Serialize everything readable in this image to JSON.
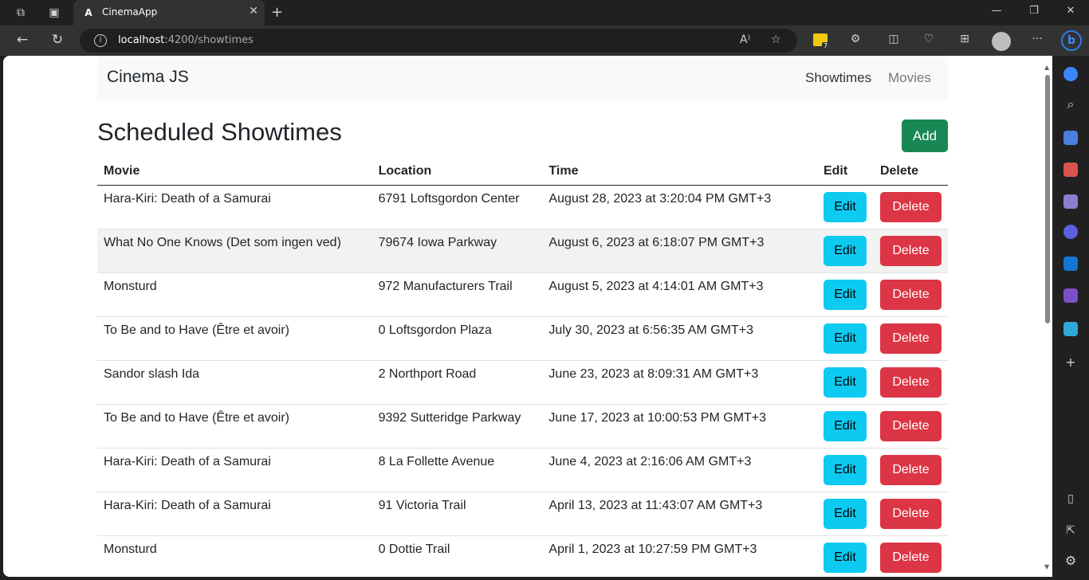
{
  "browser": {
    "tab_title": "CinemaApp",
    "tab_logo": "A",
    "url_host": "localhost",
    "url_path": ":4200/showtimes",
    "extension_badge_count": "7"
  },
  "navbar": {
    "brand": "Cinema JS",
    "links": [
      "Showtimes",
      "Movies"
    ]
  },
  "page": {
    "title": "Scheduled Showtimes",
    "add_label": "Add"
  },
  "table": {
    "headers": [
      "Movie",
      "Location",
      "Time",
      "Edit",
      "Delete"
    ],
    "edit_label": "Edit",
    "delete_label": "Delete",
    "rows": [
      {
        "movie": "Hara-Kiri: Death of a Samurai",
        "location": "6791 Loftsgordon Center",
        "time": "August 28, 2023 at 3:20:04 PM GMT+3"
      },
      {
        "movie": "What No One Knows (Det som ingen ved)",
        "location": "79674 Iowa Parkway",
        "time": "August 6, 2023 at 6:18:07 PM GMT+3"
      },
      {
        "movie": "Monsturd",
        "location": "972 Manufacturers Trail",
        "time": "August 5, 2023 at 4:14:01 AM GMT+3"
      },
      {
        "movie": "To Be and to Have (Être et avoir)",
        "location": "0 Loftsgordon Plaza",
        "time": "July 30, 2023 at 6:56:35 AM GMT+3"
      },
      {
        "movie": "Sandor slash Ida",
        "location": "2 Northport Road",
        "time": "June 23, 2023 at 8:09:31 AM GMT+3"
      },
      {
        "movie": "To Be and to Have (Être et avoir)",
        "location": "9392 Sutteridge Parkway",
        "time": "June 17, 2023 at 10:00:53 PM GMT+3"
      },
      {
        "movie": "Hara-Kiri: Death of a Samurai",
        "location": "8 La Follette Avenue",
        "time": "June 4, 2023 at 2:16:06 AM GMT+3"
      },
      {
        "movie": "Hara-Kiri: Death of a Samurai",
        "location": "91 Victoria Trail",
        "time": "April 13, 2023 at 11:43:07 AM GMT+3"
      },
      {
        "movie": "Monsturd",
        "location": "0 Dottie Trail",
        "time": "April 1, 2023 at 10:27:59 PM GMT+3"
      }
    ]
  },
  "colors": {
    "add": "#198754",
    "edit": "#0dcaf0",
    "delete": "#dc3545"
  }
}
